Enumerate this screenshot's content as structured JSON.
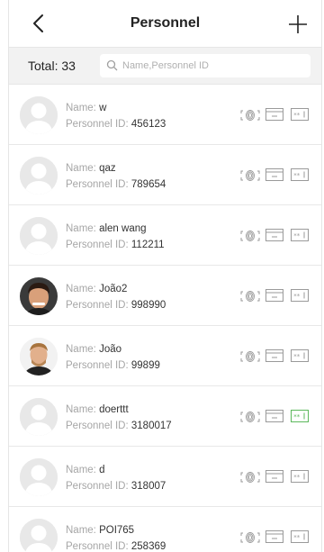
{
  "header": {
    "title": "Personnel"
  },
  "filter": {
    "total": "Total: 33",
    "search_placeholder": "Name,Personnel ID"
  },
  "labels": {
    "name": "Name:",
    "id": "Personnel ID:"
  },
  "colors": {
    "accent_active": "#5cb85c",
    "icon_gray": "#9a9a9a"
  },
  "personnel": [
    {
      "name": "w",
      "id": "456123",
      "avatar": "default",
      "card_active": false
    },
    {
      "name": "qaz",
      "id": "789654",
      "avatar": "default",
      "card_active": false
    },
    {
      "name": "alen wang",
      "id": "112211",
      "avatar": "default",
      "card_active": false
    },
    {
      "name": "João2",
      "id": "998990",
      "avatar": "photo-1",
      "card_active": false
    },
    {
      "name": "João",
      "id": "99899",
      "avatar": "photo-2",
      "card_active": false
    },
    {
      "name": "doerttt",
      "id": "3180017",
      "avatar": "default",
      "card_active": true
    },
    {
      "name": "d",
      "id": "318007",
      "avatar": "default",
      "card_active": false
    },
    {
      "name": "POI765",
      "id": "258369",
      "avatar": "default",
      "card_active": false
    }
  ]
}
